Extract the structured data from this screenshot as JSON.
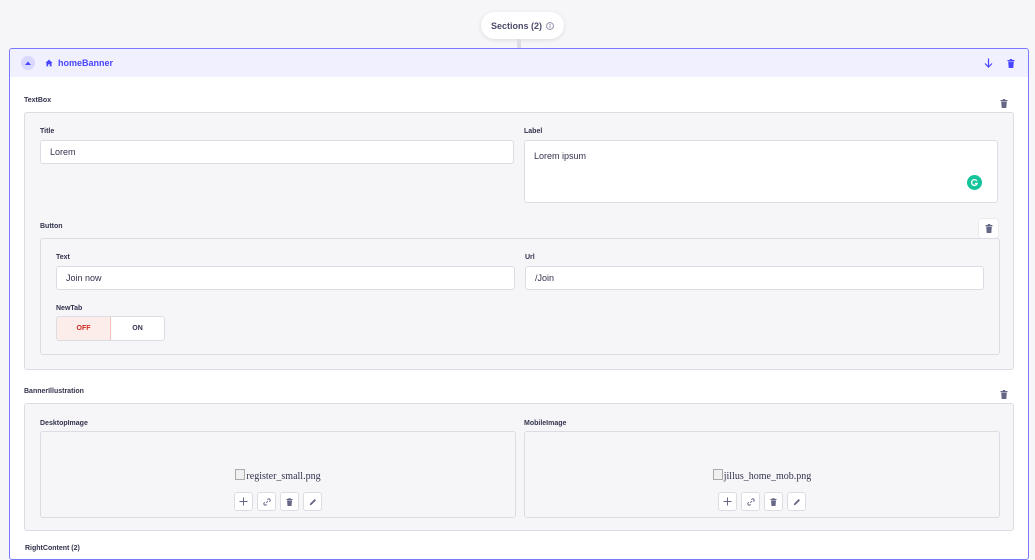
{
  "sections_pill": {
    "label": "Sections (2)"
  },
  "component": {
    "title": "homeBanner",
    "accent": "#4945ff",
    "textbox": {
      "label": "TextBox",
      "title_label": "Title",
      "title_value": "Lorem",
      "label_label": "Label",
      "label_value": "Lorem ipsum",
      "button": {
        "label": "Button",
        "text_label": "Text",
        "text_value": "Join now",
        "url_label": "Url",
        "url_value": "/Join",
        "newtab_label": "NewTab",
        "off_label": "OFF",
        "on_label": "ON"
      }
    },
    "banner_illustration": {
      "label": "BannerIllustration",
      "desktop_label": "DesktopImage",
      "desktop_file": "register_small.png",
      "mobile_label": "MobileImage",
      "mobile_file": "jillus_home_mob.png"
    },
    "next_section_label": "RightContent (2)"
  }
}
